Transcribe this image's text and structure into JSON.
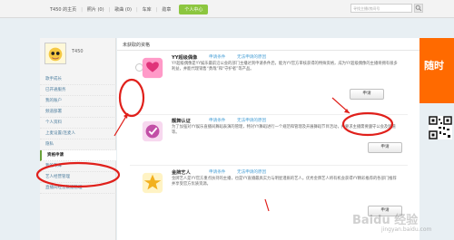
{
  "nav": {
    "items": [
      "T450 的主页",
      "照片 (0)",
      "歌曲 (0)",
      "车库",
      "勋章"
    ],
    "active": "个人中心"
  },
  "search": {
    "placeholder": "寻找主播/房间号"
  },
  "sidebar": {
    "username": "T450",
    "items": [
      "歌手成长",
      "已开通服务",
      "我的账户",
      "频道部署",
      "个人资料",
      "上麦设置/连麦人",
      "隐私",
      "资格申请",
      "我的车库",
      "艺人经营管理",
      "直播间经营数据管理"
    ],
    "selected_index": 7
  },
  "main": {
    "tab": "未获取的资格",
    "qualifications": [
      {
        "title": "YY超级偶像",
        "link1": "申请条件",
        "link2": "无法申请的原因",
        "desc": "YY超级偶像是YY娱乐最前沿公会的部门主播达到申请条件后，能为YY官方审核获得的特殊资格，成为YY超级偶像的主播将拥有很多利益，并能代理销售“勇哉”和“守护者”等产品。",
        "button": "申请"
      },
      {
        "title": "靓舞认证",
        "link1": "申请条件",
        "link2": "无法申请的原因",
        "desc": "为了加强对YY娱乐直播间舞蹈表演的管理，特对YY舞蹈进行一个规范和管理及开展舞蹈节目活动，并要求主播需要遵守公会及频道等。",
        "button": "申请"
      },
      {
        "title": "金牌艺人",
        "link1": "申请条件",
        "link2": "无法申请的原因",
        "desc": "金牌艺人是YY官方重点扶持的主播，也是YY直播最具实力与明星潜质的艺人。优秀金牌艺人将有机会获得YY精彩推荐的各部门推荐并享受官方优质资源。",
        "button": "申请"
      }
    ]
  },
  "banner": {
    "text": "随时"
  },
  "watermark": {
    "text": "Baidu 经验",
    "sub": "jingyan.baidu.com"
  },
  "colors": {
    "accent_green": "#8cc63f",
    "link_blue": "#4aa0d6",
    "annotation_red": "#e0201b",
    "banner_orange": "#ff6a00"
  }
}
